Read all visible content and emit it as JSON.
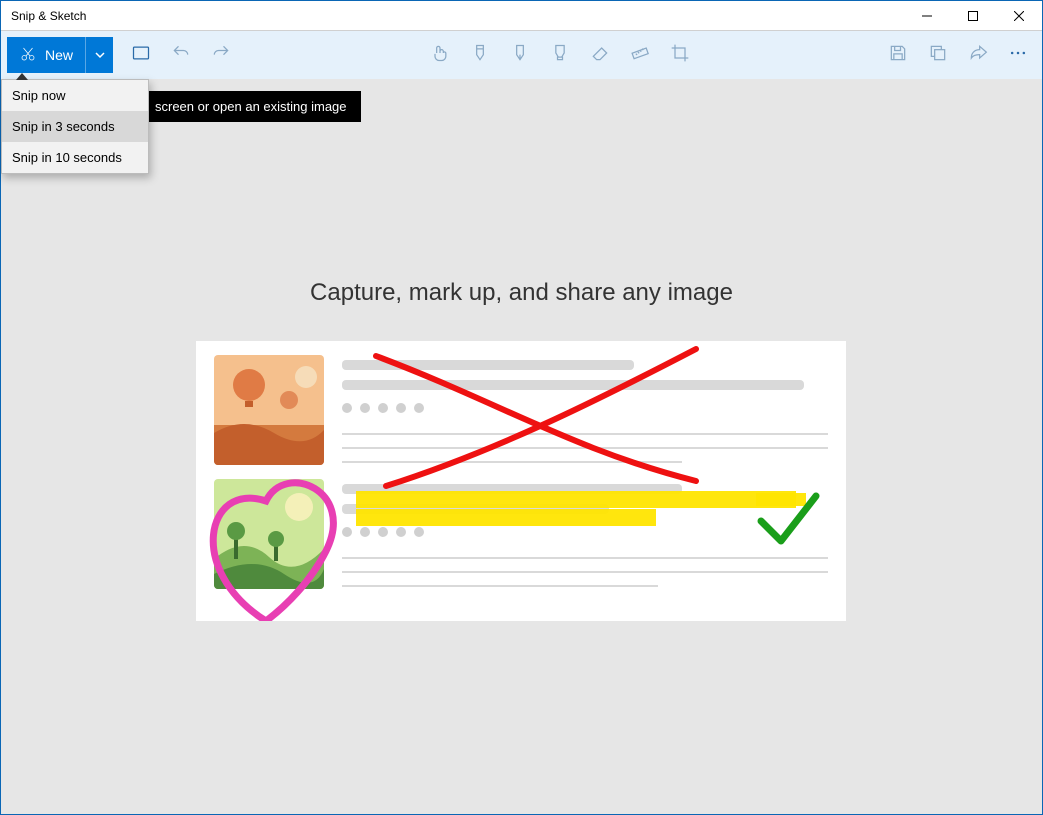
{
  "window": {
    "title": "Snip & Sketch"
  },
  "toolbar": {
    "new_label": "New",
    "new_menu": {
      "snip_now": "Snip now",
      "snip_3s": "Snip in 3 seconds",
      "snip_10s": "Snip in 10 seconds"
    }
  },
  "tooltip": {
    "text": "screen or open an existing image"
  },
  "content": {
    "headline": "Capture, mark up, and share any image"
  },
  "icons": {
    "snip": "snip-icon",
    "chevron_down": "chevron-down-icon",
    "open": "open-folder-icon",
    "undo": "undo-icon",
    "redo": "redo-icon",
    "touch": "touch-write-icon",
    "ballpoint": "ballpoint-pen-icon",
    "pencil": "pencil-pen-icon",
    "highlighter": "highlighter-pen-icon",
    "eraser": "eraser-icon",
    "ruler": "ruler-icon",
    "crop": "crop-icon",
    "save": "save-icon",
    "copy": "copy-icon",
    "share": "share-icon",
    "more": "more-icon"
  },
  "colors": {
    "accent": "#0078d7",
    "toolbar_bg": "#e5f1fb",
    "window_border": "#0a66b5"
  }
}
